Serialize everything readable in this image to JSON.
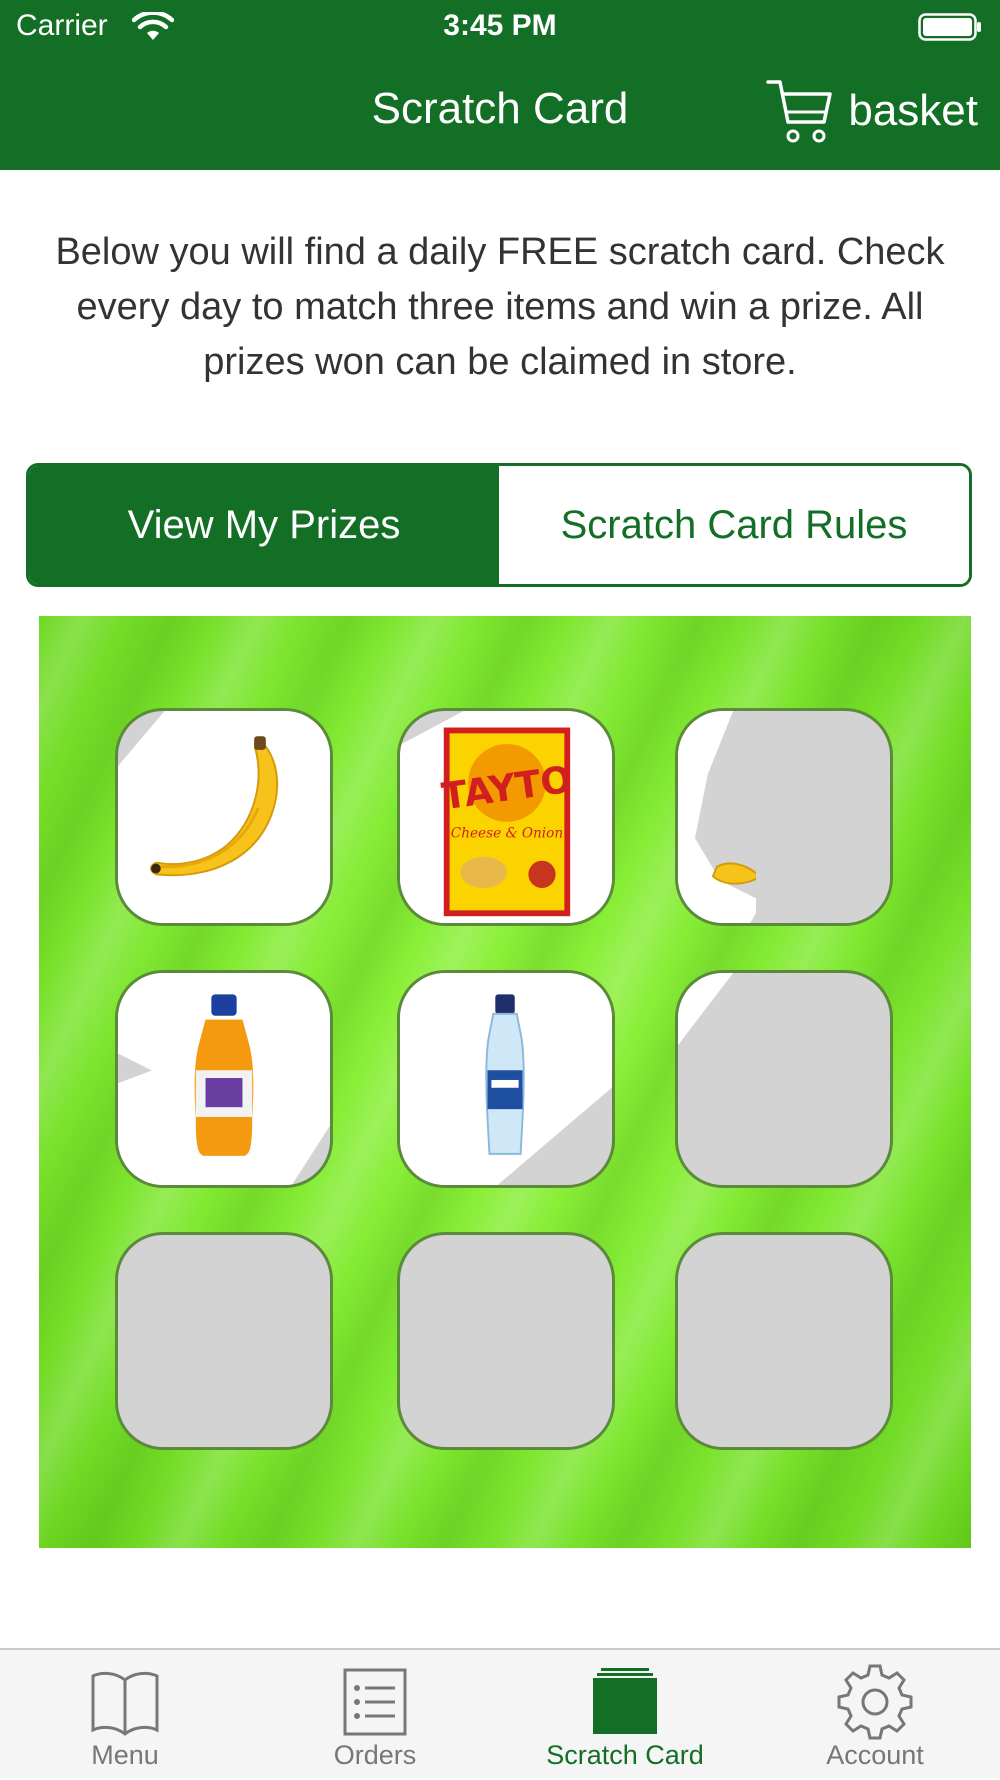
{
  "status_bar": {
    "carrier": "Carrier",
    "time": "3:45 PM"
  },
  "nav": {
    "title": "Scratch Card",
    "basket_label": "basket",
    "basket_icon": "cart-icon"
  },
  "intro_text": "Below you will find a daily FREE scratch card. Check every day to match three items and win a prize. All prizes won can be claimed in store.",
  "segments": [
    {
      "label": "View My Prizes",
      "selected": true
    },
    {
      "label": "Scratch Card Rules",
      "selected": false
    }
  ],
  "scratch_tiles": [
    {
      "item": "banana",
      "state": "scratched"
    },
    {
      "item": "tayto-crisps",
      "state": "scratched"
    },
    {
      "item": "banana",
      "state": "partially-scratched"
    },
    {
      "item": "orange-juice-bottle",
      "state": "scratched"
    },
    {
      "item": "water-bottle",
      "state": "scratched"
    },
    {
      "item": "",
      "state": "unscratched"
    },
    {
      "item": "",
      "state": "unscratched"
    },
    {
      "item": "",
      "state": "unscratched"
    },
    {
      "item": "",
      "state": "unscratched"
    }
  ],
  "tabs": [
    {
      "label": "Menu",
      "icon": "book-icon",
      "selected": false
    },
    {
      "label": "Orders",
      "icon": "list-icon",
      "selected": false
    },
    {
      "label": "Scratch Card",
      "icon": "card-stack-icon",
      "selected": true
    },
    {
      "label": "Account",
      "icon": "gear-icon",
      "selected": false
    }
  ],
  "colors": {
    "brand_green": "#136e26",
    "card_green": "#7fe830",
    "scratch_grey": "#d3d3d3"
  }
}
